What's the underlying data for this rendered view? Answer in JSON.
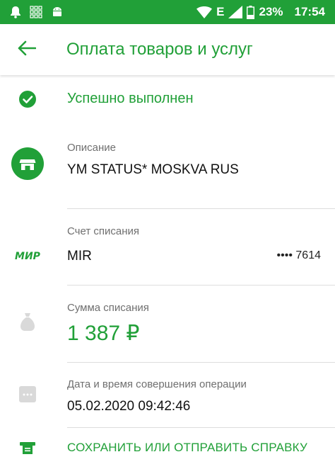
{
  "statusbar": {
    "battery": "23%",
    "time": "17:54",
    "network": "E"
  },
  "header": {
    "title": "Оплата товаров и услуг"
  },
  "operation": {
    "status": "Успешно выполнен",
    "description_label": "Описание",
    "description_value": "YM STATUS* MOSKVA RUS",
    "account_label": "Счет списания",
    "account_brand": "МИР",
    "account_value": "MIR",
    "account_number": "•••• 7614",
    "amount_label": "Сумма списания",
    "amount_value": "1 387 ₽",
    "datetime_label": "Дата и время совершения операции",
    "datetime_value": "05.02.2020 09:42:46"
  },
  "actions": {
    "save_send": "СОХРАНИТЬ ИЛИ ОТПРАВИТЬ СПРАВКУ"
  },
  "colors": {
    "accent": "#21a038",
    "icon_gray": "#d9d9d9"
  },
  "icons": [
    "notification-icon",
    "grid-app-icon",
    "android-icon",
    "wifi-icon",
    "signal-icon",
    "battery-icon",
    "back-arrow-icon",
    "check-circle-icon",
    "store-icon",
    "mir-logo-icon",
    "money-bag-icon",
    "calendar-icon",
    "receipt-icon"
  ]
}
